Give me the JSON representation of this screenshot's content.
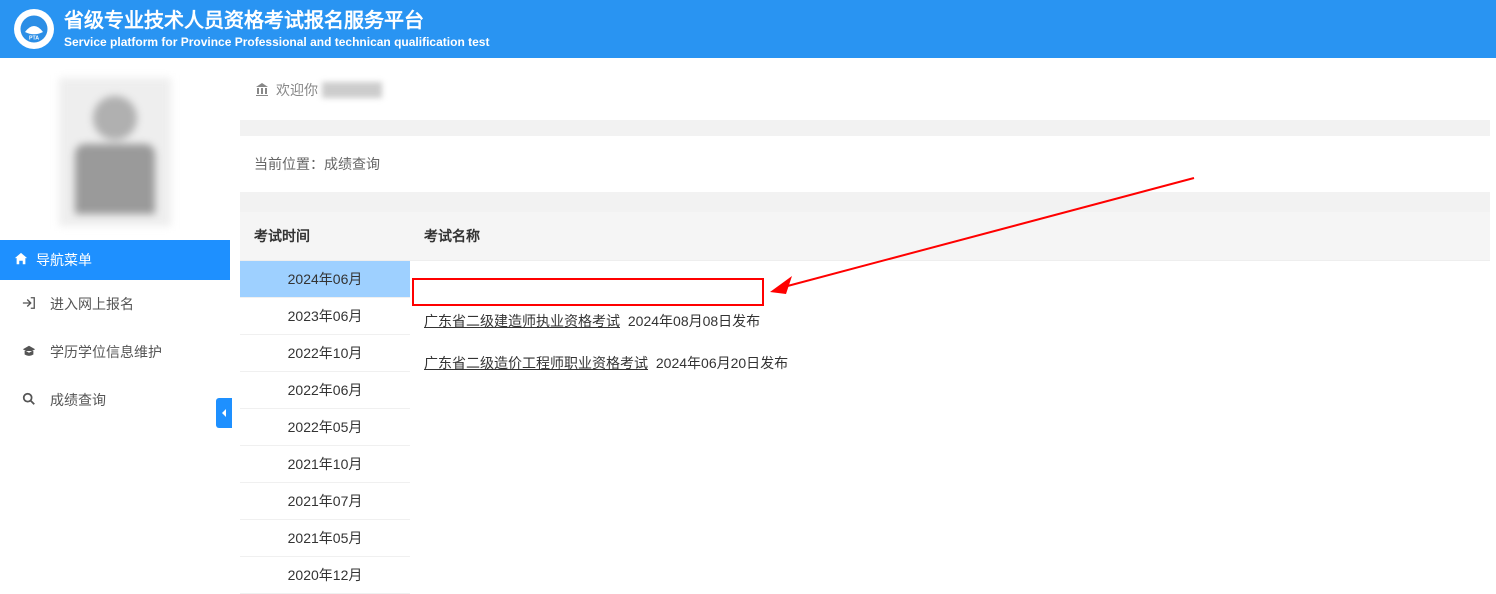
{
  "header": {
    "title": "省级专业技术人员资格考试报名服务平台",
    "subtitle": "Service platform for Province Professional and technican qualification test",
    "logo_text": "PTA"
  },
  "sidebar": {
    "nav_header": "导航菜单",
    "items": [
      {
        "icon": "login-icon",
        "label": "进入网上报名"
      },
      {
        "icon": "graduation-icon",
        "label": "学历学位信息维护"
      },
      {
        "icon": "search-icon",
        "label": "成绩查询"
      }
    ]
  },
  "main": {
    "welcome_prefix": "欢迎你",
    "breadcrumb_label": "当前位置：",
    "breadcrumb_value": "成绩查询",
    "columns": {
      "time": "考试时间",
      "name": "考试名称"
    },
    "times": [
      {
        "label": "2024年06月",
        "active": true
      },
      {
        "label": "2023年06月"
      },
      {
        "label": "2022年10月"
      },
      {
        "label": "2022年06月"
      },
      {
        "label": "2022年05月"
      },
      {
        "label": "2021年10月"
      },
      {
        "label": "2021年07月"
      },
      {
        "label": "2021年05月"
      },
      {
        "label": "2020年12月"
      }
    ],
    "exams": [
      {
        "link": "广东省二级建造师执业资格考试",
        "date": "2024年08月08日发布",
        "highlight": true
      },
      {
        "link": "广东省二级造价工程师职业资格考试",
        "date": "2024年06月20日发布",
        "highlight": false
      }
    ]
  }
}
